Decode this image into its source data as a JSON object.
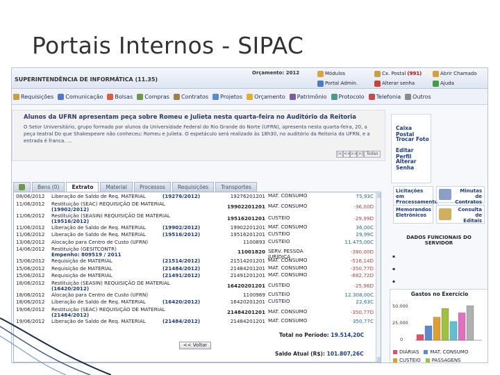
{
  "slide": {
    "title": "Portais Internos - SIPAC"
  },
  "topbar": {
    "org": "SUPERINTENDÊNCIA DE INFORMÁTICA (11.35)",
    "budget": "Orçamento: 2012",
    "buttons": [
      {
        "label": "Módulos",
        "icon": "modules-icon",
        "color": "#e2a23a"
      },
      {
        "label": "Portal Admin.",
        "icon": "portal-admin-icon",
        "color": "#4a7ac8"
      },
      {
        "label": "Cx. Postal",
        "badge": "(991)",
        "icon": "mailbox-icon",
        "color": "#c8a040"
      },
      {
        "label": "Alterar senha",
        "icon": "change-password-icon",
        "color": "#c84040"
      },
      {
        "label": "Abrir Chamado",
        "icon": "open-ticket-icon",
        "color": "#d8a030"
      },
      {
        "label": "Ajuda",
        "icon": "help-icon",
        "color": "#40a040"
      }
    ]
  },
  "menu": [
    {
      "label": "Requisições",
      "color": "#c8a040"
    },
    {
      "label": "Comunicação",
      "color": "#4a7ac8"
    },
    {
      "label": "Bolsas",
      "color": "#d86040"
    },
    {
      "label": "Compras",
      "color": "#6a9a4a"
    },
    {
      "label": "Contratos",
      "color": "#a08040"
    },
    {
      "label": "Projetos",
      "color": "#5a8ad0"
    },
    {
      "label": "Orçamento",
      "color": "#e0b030"
    },
    {
      "label": "Patrimônio",
      "color": "#7a5aa0"
    },
    {
      "label": "Protocolo",
      "color": "#4a9a8a"
    },
    {
      "label": "Telefonia",
      "color": "#c84a4a"
    },
    {
      "label": "Outros",
      "color": "#8a8a8a"
    }
  ],
  "news": {
    "headline": "Alunos da UFRN apresentam peça sobre Romeu e Julieta nesta quarta-feira no Auditório da Reitoria",
    "body": "O Setor Universitário, grupo formado por alunos da Universidade Federal do Rio Grande do Norte (UFRN), apresenta nesta quarta-feira, 20, a peça teatral Do que Shakespeare não conheceu: Romeu e Julieta. O espetáculo será realizado às 18h30, no auditório da Reitoria da UFRN, e a entrada é franca. ...",
    "pager": [
      "|<",
      "<<",
      ">>",
      ">|"
    ],
    "all_label": "Todas"
  },
  "side_links": [
    "Caixa Postal",
    "Trocar Foto",
    "Editar Perfil",
    "Alterar Senha"
  ],
  "tabs": [
    "Bens (0)",
    "Extrato",
    "Material",
    "Processos",
    "Requisições",
    "Transportes"
  ],
  "statement": {
    "rows": [
      {
        "date": "08/06/2012",
        "desc": "Liberação de Saldo de Req. MATERIAL",
        "doc": "(19276/2012)",
        "code": "19276201201",
        "type": "MAT. CONSUMO",
        "value": "75,93C",
        "sign": "pos"
      },
      {
        "date": "11/06/2012",
        "desc": "Restituição (SEAC)  REQUISIÇÃO DE MATERIAL",
        "doc": "(19902/2012)",
        "code": "19902201201",
        "type": "MAT. CONSUMO",
        "value": "-36,00D",
        "sign": "neg"
      },
      {
        "date": "11/06/2012",
        "desc": "Restituição (SEASIN)  REQUISIÇÃO DE MATERIAL",
        "doc": "(19516/2012)",
        "code": "19516201201",
        "type": "CUSTEIO",
        "value": "-29,99D",
        "sign": "neg"
      },
      {
        "date": "11/06/2012",
        "desc": "Liberação de Saldo de Req. MATERIAL",
        "doc": "(19902/2012)",
        "code": "19902201201",
        "type": "MAT. CONSUMO",
        "value": "36,00C",
        "sign": "pos"
      },
      {
        "date": "11/06/2012",
        "desc": "Liberação de Saldo de Req. MATERIAL",
        "doc": "(19516/2012)",
        "code": "19516201201",
        "type": "CUSTEIO",
        "value": "29,99C",
        "sign": "pos"
      },
      {
        "date": "13/06/2012",
        "desc": "Alocação para Centro de Custo (UFRN)",
        "doc": "",
        "code": "1100893",
        "type": "CUSTEIO",
        "value": "11.475,00C",
        "sign": "pos"
      },
      {
        "date": "14/06/2012",
        "desc": "Restituição (GESITCONTR)",
        "doc": "Empenho: 809519 / 2011",
        "code": "11001820",
        "type": "SERV. PESSOA JURÍDICA",
        "value": "-380,00D",
        "sign": "neg"
      },
      {
        "date": "15/06/2012",
        "desc": "Requisição de MATERIAL",
        "doc": "(21514/2012)",
        "code": "21514201201",
        "type": "MAT. CONSUMO",
        "value": "-516,14D",
        "sign": "neg"
      },
      {
        "date": "15/06/2012",
        "desc": "Requisição de MATERIAL",
        "doc": "(21484/2012)",
        "code": "21484201201",
        "type": "MAT. CONSUMO",
        "value": "-350,77D",
        "sign": "neg"
      },
      {
        "date": "15/06/2012",
        "desc": "Requisição de MATERIAL",
        "doc": "(21491/2012)",
        "code": "21491201201",
        "type": "MAT. CONSUMO",
        "value": "-882,72D",
        "sign": "neg"
      },
      {
        "date": "18/06/2012",
        "desc": "Restituição (SEASIN)  REQUISIÇÃO DE MATERIAL",
        "doc": "(16420/2012)",
        "code": "16420201201",
        "type": "CUSTEIO",
        "value": "-25,96D",
        "sign": "neg"
      },
      {
        "date": "18/06/2012",
        "desc": "Alocação para Centro de Custo (UFRN)",
        "doc": "",
        "code": "1100969",
        "type": "CUSTEIO",
        "value": "12.308,00C",
        "sign": "pos"
      },
      {
        "date": "18/06/2012",
        "desc": "Liberação de Saldo de Req. MATERIAL",
        "doc": "(16420/2012)",
        "code": "16420201201",
        "type": "CUSTEIO",
        "value": "22,63C",
        "sign": "pos"
      },
      {
        "date": "19/06/2012",
        "desc": "Restituição (SEAC)  REQUISIÇÃO DE MATERIAL",
        "doc": "(21484/2012)",
        "code": "21484201201",
        "type": "MAT. CONSUMO",
        "value": "-350,77D",
        "sign": "neg"
      },
      {
        "date": "19/06/2012",
        "desc": "Liberação de Saldo de Req. MATERIAL",
        "doc": "(21484/2012)",
        "code": "21484201201",
        "type": "MAT. CONSUMO",
        "value": "350,77C",
        "sign": "pos"
      }
    ],
    "total_label": "Total no Período:",
    "total_value": "19.514,20C",
    "back_label": "<< Voltar",
    "saldo_label": "Saldo Atual (R$):",
    "saldo_value": "101.807,26C"
  },
  "tiles": {
    "licitacoes": "Licitações em Processamento no DMP",
    "minutas": "Minutas de Contratos",
    "memorandos": "Memorandos Eletrônicos",
    "editais": "Consulta de Editais",
    "dados": "DADOS FUNCIONAIS DO SERVIDOR"
  },
  "chart_data": {
    "type": "bar",
    "title": "Gastos no Exercício",
    "ylim": [
      0,
      50000
    ],
    "yticks": [
      "50.000",
      "25.000",
      "0"
    ],
    "series": [
      {
        "name": "DIÁRIAS",
        "color": "#e0506a",
        "value": 8000
      },
      {
        "name": "MAT. CONSUMO",
        "color": "#5a8ad0",
        "value": 20000
      },
      {
        "name": "CUSTEIO",
        "color": "#e0a030",
        "value": 32000
      },
      {
        "name": "PASSAGENS",
        "color": "#a0c040",
        "value": 44000
      }
    ],
    "extra_bars": [
      {
        "color": "#60c0d0",
        "value": 26000
      },
      {
        "color": "#e070c0",
        "value": 38000
      },
      {
        "color": "#b0b0b0",
        "value": 48000
      }
    ]
  }
}
